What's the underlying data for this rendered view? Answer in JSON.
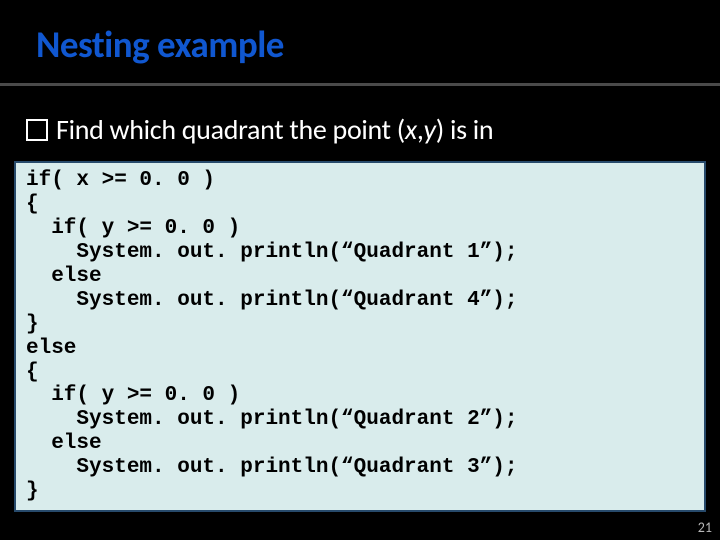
{
  "slide": {
    "title": "Nesting example",
    "bullet_prefix": "Find which quadrant the point (",
    "bullet_xy_x": "x",
    "bullet_sep": ",",
    "bullet_xy_y": "y",
    "bullet_suffix": ") is in",
    "code": "if( x >= 0. 0 )\n{\n  if( y >= 0. 0 )\n    System. out. println(“Quadrant 1”);\n  else\n    System. out. println(“Quadrant 4”);\n}\nelse\n{\n  if( y >= 0. 0 )\n    System. out. println(“Quadrant 2”);\n  else\n    System. out. println(“Quadrant 3”);\n}",
    "page_number": "21"
  }
}
